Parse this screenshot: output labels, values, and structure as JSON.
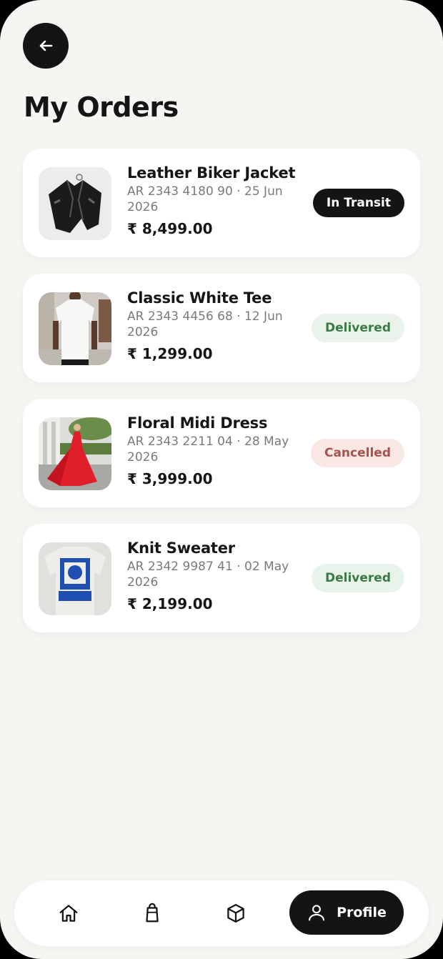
{
  "header": {
    "title": "My Orders"
  },
  "icons": {
    "back": "arrow-left-icon",
    "home": "home-icon",
    "bag": "shopping-bag-icon",
    "box": "box-icon",
    "profile": "user-icon"
  },
  "orders": [
    {
      "name": "Leather Biker Jacket",
      "meta": "AR 2343 4180 90 · 25 Jun 2026",
      "price": "₹ 8,499.00",
      "status": "In Transit"
    },
    {
      "name": "Classic White Tee",
      "meta": "AR 2343 4456 68 · 12 Jun 2026",
      "price": "₹ 1,299.00",
      "status": "Delivered"
    },
    {
      "name": "Floral Midi Dress",
      "meta": "AR 2343 2211 04 · 28 May 2026",
      "price": "₹ 3,999.00",
      "status": "Cancelled"
    },
    {
      "name": "Knit Sweater",
      "meta": "AR 2342 9987 41 · 02 May 2026",
      "price": "₹ 2,199.00",
      "status": "Delivered"
    }
  ],
  "nav": {
    "active_label": "Profile"
  },
  "colors": {
    "background": "#f6f5f2",
    "dark": "#141414",
    "delivered": "#3a7a44",
    "cancelled": "#a9524b"
  }
}
